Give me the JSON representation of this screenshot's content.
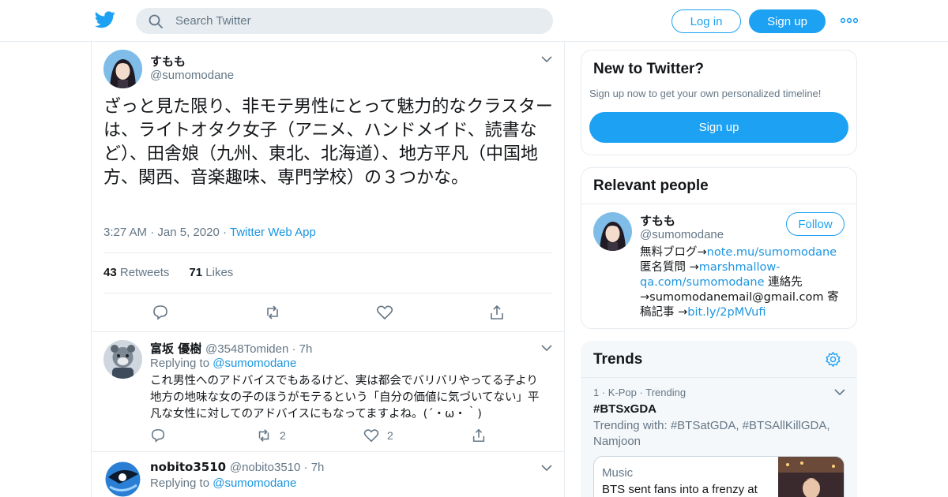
{
  "header": {
    "search_placeholder": "Search Twitter",
    "login_label": "Log in",
    "signup_label": "Sign up"
  },
  "main_tweet": {
    "name": "すもも",
    "handle": "@sumomodane",
    "text": "ざっと見た限り、非モテ男性にとって魅力的なクラスターは、ライトオタク女子（アニメ、ハンドメイド、読書など）、田舎娘（九州、東北、北海道）、地方平凡（中国地方、関西、音楽趣味、専門学校）の３つかな。",
    "time": "3:27 AM",
    "date": "Jan 5, 2020",
    "source": "Twitter Web App",
    "retweets_count": "43",
    "retweets_label": "Retweets",
    "likes_count": "71",
    "likes_label": "Likes"
  },
  "replies": [
    {
      "name": "富坂 優樹",
      "handle": "@3548Tomiden",
      "age": "7h",
      "replying_prefix": "Replying to",
      "replying_to": "@sumomodane",
      "text": "これ男性へのアドバイスでもあるけど、実は都会でバリバリやってる子より地方の地味な女の子のほうがモテるという「自分の価値に気づいてない」平凡な女性に対してのアドバイスにもなってますよね。(´・ω・｀)",
      "retweets": "2",
      "likes": "2"
    },
    {
      "name": "nobito3510",
      "handle": "@nobito3510",
      "age": "7h",
      "replying_prefix": "Replying to",
      "replying_to": "@sumomodane"
    }
  ],
  "sidebar": {
    "new": {
      "title": "New to Twitter?",
      "subtitle": "Sign up now to get your own personalized timeline!",
      "button": "Sign up"
    },
    "relevant": {
      "title": "Relevant people",
      "name": "すもも",
      "handle": "@sumomodane",
      "follow_label": "Follow",
      "bio_1": "無料ブログ→",
      "bio_link_1": "note.mu/sumomodane",
      "bio_2": " 匿名質問 →",
      "bio_link_2": "marshmallow-qa.com/sumomodane",
      "bio_3": " 連絡先→sumomodanemail@gmail.com 寄稿記事 →",
      "bio_link_3": "bit.ly/2pMVufi"
    },
    "trends": {
      "title": "Trends",
      "meta": "1 · K-Pop · Trending",
      "name": "#BTSxGDA",
      "with": "Trending with: #BTSatGDA, #BTSAllKillGDA, Namjoon",
      "news_category": "Music",
      "news_headline": "BTS sent fans into a frenzy at"
    }
  },
  "colors": {
    "accent": "#1da1f2",
    "link": "#1b95e0",
    "muted": "#657786",
    "border": "#e6ecf0"
  }
}
